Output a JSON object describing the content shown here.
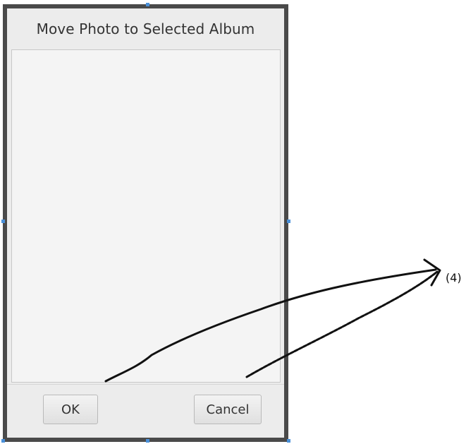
{
  "dialog": {
    "title": "Move Photo to Selected Album",
    "buttons": {
      "ok_label": "OK",
      "cancel_label": "Cancel"
    }
  },
  "annotation": {
    "label": "(4)"
  },
  "colors": {
    "frame": "#4a4a4a",
    "dialog_background": "#ececec",
    "list_background": "#f4f4f4",
    "handle_accent": "#4a90d9",
    "annotation_ink": "#111111"
  }
}
